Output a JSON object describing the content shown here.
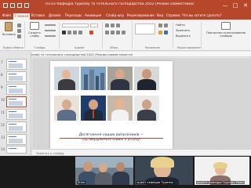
{
  "window": {
    "title": "03.03 Кафедра туризму та готельного господарства 2022 [Режим совместимости] - PowerPoint (Сбой активации продукта)",
    "controls": {
      "minimize": "—",
      "maximize": "□",
      "close": "✕"
    }
  },
  "ribbon": {
    "tabs": [
      "Файл",
      "Главная",
      "Вставка",
      "Дизайн",
      "Переходы",
      "Анимация",
      "Слайд-шоу",
      "Рецензирование",
      "Вид",
      "Справка",
      "Что вы хотите сделать?"
    ],
    "active_tab_index": 1,
    "buttons": {
      "paste": "Вставить",
      "create_slide": "Создать слайд",
      "find": "Найти",
      "replace": "Заменить",
      "select": "Выделить",
      "reuse_slides": "Повторное использование слайдов"
    },
    "groups": [
      "Буфер обмена",
      "Слайды",
      "Шрифт",
      "Абзац",
      "Рисование",
      "Редактирование"
    ]
  },
  "slide_path": "03.03 Кафедра туризму та готельного господарства 2022 (Режим совместимости)",
  "slides": {
    "numbers": [
      "7",
      "8",
      "9",
      "10",
      "11",
      "12",
      "13",
      "14"
    ],
    "active_index": 3
  },
  "slide": {
    "caption_line1": "Досягнення наших випускників —",
    "caption_line2": "підтвердження нашого успіху!"
  },
  "notes_placeholder": "Заметки к слайду",
  "video": {
    "participants": [
      {
        "label": "Знак"
      },
      {
        "label": "оцент кафедри Туризму"
      },
      {
        "label": "доцент кафедри Туризму Марія"
      }
    ]
  },
  "colors": {
    "brand": "#b7472a",
    "caption_accent": "#b7472a"
  }
}
